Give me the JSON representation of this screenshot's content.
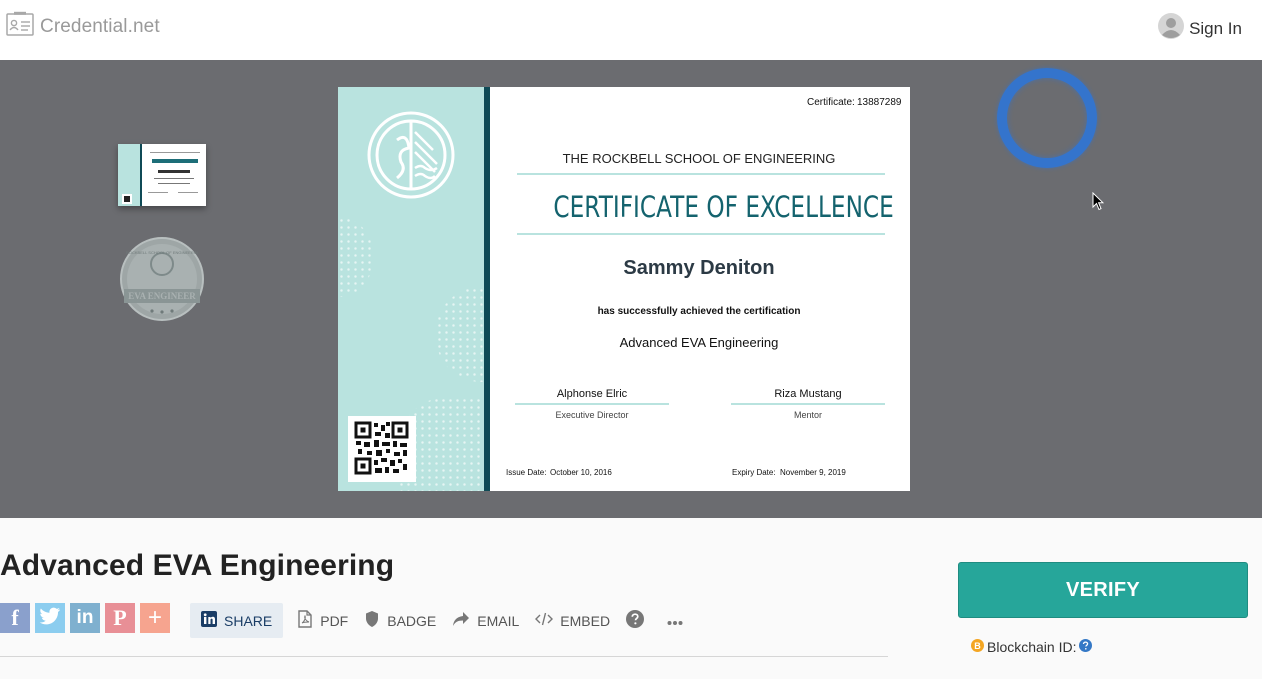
{
  "header": {
    "brand": "Credential.net",
    "sign_in": "Sign In"
  },
  "certificate": {
    "number_label": "Certificate:",
    "number": "13887289",
    "school": "THE ROCKBELL SCHOOL OF ENGINEERING",
    "heading": "CERTIFICATE OF EXCELLENCE",
    "recipient": "Sammy Deniton",
    "statement": "has successfully achieved the certification",
    "course": "Advanced EVA Engineering",
    "signatory_1": {
      "name": "Alphonse Elric",
      "role": "Executive Director"
    },
    "signatory_2": {
      "name": "Riza Mustang",
      "role": "Mentor"
    },
    "issue_label": "Issue Date:",
    "issue_date": "October 10, 2016",
    "expiry_label": "Expiry Date:",
    "expiry_date": "November 9, 2019",
    "accent_color": "#0f4a56",
    "panel_color": "#b9e3df"
  },
  "thumbnails": {
    "badge_label": "EVA ENGINEER",
    "badge_top_text": "ROCKBELL SCHOOL OF ENGINEERING"
  },
  "main": {
    "title": "Advanced EVA Engineering",
    "toolbar": {
      "share": "SHARE",
      "pdf": "PDF",
      "badge": "BADGE",
      "email": "EMAIL",
      "embed": "EMBED"
    },
    "verify": "VERIFY",
    "blockchain_label": "Blockchain ID:",
    "verify_color": "#26a69a"
  },
  "social": {
    "facebook_color": "#8aa0cc",
    "twitter_color": "#8ccdef",
    "linkedin_color": "#7fb0cf",
    "pinterest_color": "#e88f96",
    "more_color": "#f6a48f"
  }
}
